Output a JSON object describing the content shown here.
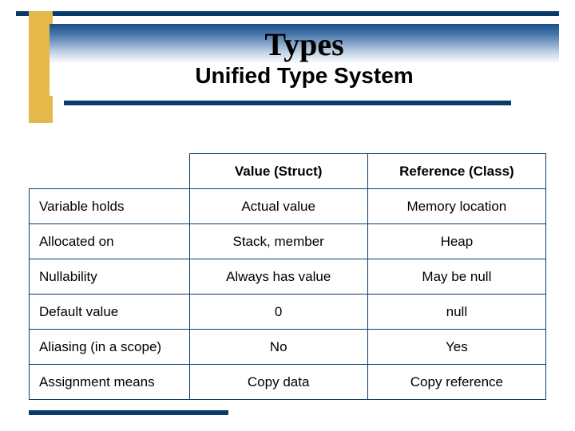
{
  "heading": {
    "title": "Types",
    "subtitle": "Unified Type System"
  },
  "table": {
    "columns": [
      "Value  (Struct)",
      "Reference (Class)"
    ],
    "rows": [
      {
        "label": "Variable holds",
        "cells": [
          "Actual value",
          "Memory location"
        ]
      },
      {
        "label": "Allocated on",
        "cells": [
          "Stack, member",
          "Heap"
        ]
      },
      {
        "label": "Nullability",
        "cells": [
          "Always has value",
          "May be null"
        ]
      },
      {
        "label": "Default value",
        "cells": [
          "0",
          "null"
        ]
      },
      {
        "label": "Aliasing (in a scope)",
        "cells": [
          "No",
          "Yes"
        ]
      },
      {
        "label": "Assignment means",
        "cells": [
          "Copy data",
          "Copy reference"
        ]
      }
    ]
  }
}
